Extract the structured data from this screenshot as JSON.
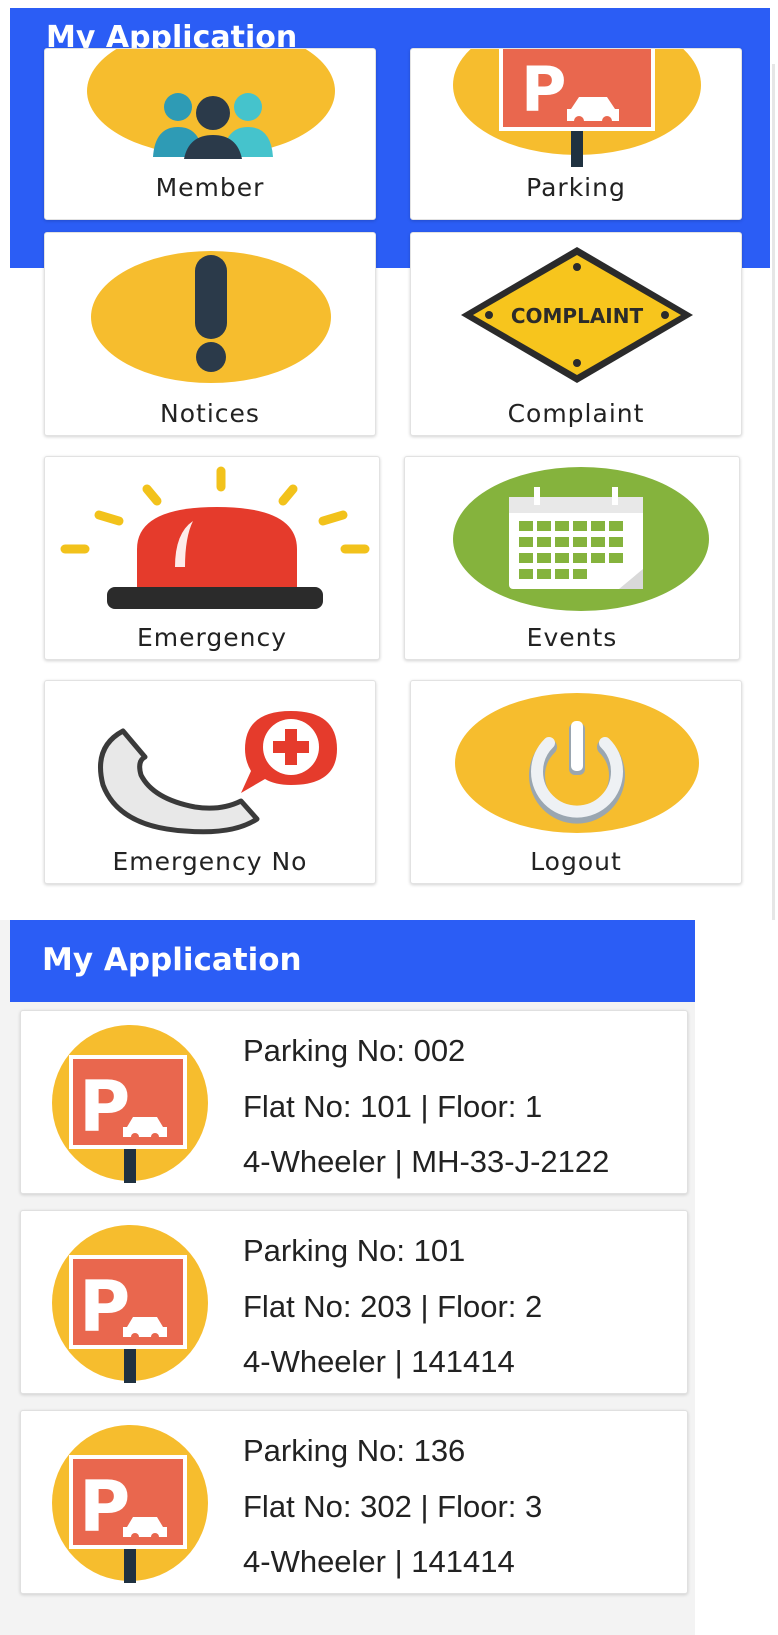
{
  "screen1": {
    "app_title": "My Application",
    "tiles": [
      {
        "label": "Member",
        "icon": "members-icon"
      },
      {
        "label": "Parking",
        "icon": "parking-sign-icon"
      },
      {
        "label": "Notices",
        "icon": "exclamation-icon"
      },
      {
        "label": "Complaint",
        "icon": "complaint-sign-icon",
        "sign_text": "COMPLAINT"
      },
      {
        "label": "Emergency",
        "icon": "siren-icon"
      },
      {
        "label": "Events",
        "icon": "calendar-icon"
      },
      {
        "label": "Emergency No",
        "icon": "emergency-phone-icon"
      },
      {
        "label": "Logout",
        "icon": "power-icon"
      }
    ]
  },
  "screen2": {
    "app_title": "My Application",
    "parkings": [
      {
        "parking": "Parking No: 002",
        "flat": "Flat No: 101 | Floor: 1",
        "vehicle": "4-Wheeler | MH-33-J-2122"
      },
      {
        "parking": "Parking No: 101",
        "flat": "Flat No: 203 | Floor: 2",
        "vehicle": "4-Wheeler | 141414"
      },
      {
        "parking": "Parking No: 136",
        "flat": "Flat No: 302 | Floor: 3",
        "vehicle": "4-Wheeler | 141414"
      }
    ]
  },
  "colors": {
    "appbar": "#2b5df5",
    "icon_circle": "#f6bd2e",
    "parking_sign": "#e9674e",
    "events_circle": "#85b33d",
    "siren_red": "#e53b2c"
  }
}
